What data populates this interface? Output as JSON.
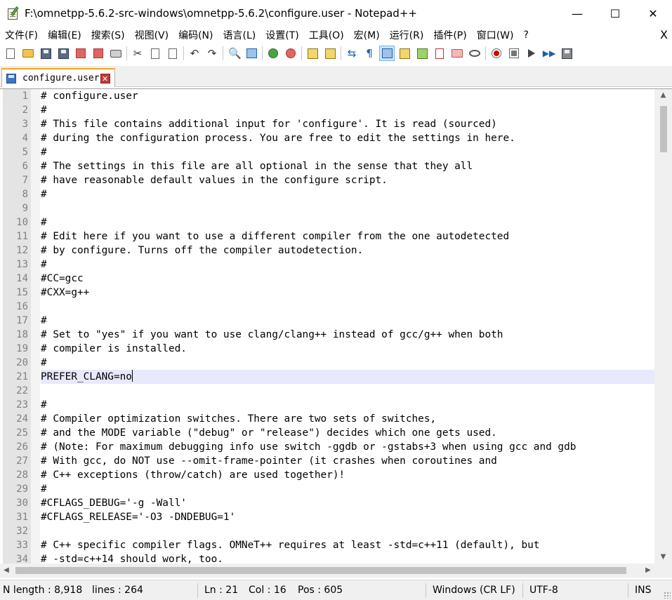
{
  "window": {
    "title": "F:\\omnetpp-5.6.2-src-windows\\omnetpp-5.6.2\\configure.user - Notepad++",
    "minimize_glyph": "—",
    "maximize_glyph": "☐",
    "close_glyph": "✕"
  },
  "menu": {
    "items": [
      "文件(F)",
      "编辑(E)",
      "搜索(S)",
      "视图(V)",
      "编码(N)",
      "语言(L)",
      "设置(T)",
      "工具(O)",
      "宏(M)",
      "运行(R)",
      "插件(P)",
      "窗口(W)",
      "?"
    ],
    "close_glyph": "X"
  },
  "toolbar": {
    "icons": [
      "new-file-icon",
      "open-file-icon",
      "save-icon",
      "save-all-icon",
      "close-icon",
      "close-all-icon",
      "print-icon",
      "cut-icon",
      "copy-icon",
      "paste-icon",
      "undo-icon",
      "redo-icon",
      "find-icon",
      "replace-icon",
      "zoom-in-icon",
      "zoom-out-icon",
      "sync-vertical-icon",
      "sync-horizontal-icon",
      "word-wrap-icon",
      "show-all-chars-icon",
      "indent-guide-icon",
      "user-language-icon",
      "doc-map-icon",
      "function-list-icon",
      "folder-workspace-icon",
      "monitor-icon",
      "record-macro-icon",
      "stop-record-icon",
      "play-macro-icon",
      "run-macro-multiple-icon",
      "save-macro-icon"
    ],
    "undo_glyph": "↶",
    "redo_glyph": "↷",
    "cut_glyph": "✂",
    "paragraph_glyph": "¶",
    "wrap_glyph": "⇆",
    "ff_glyph": "▶▶",
    "find_glyph": "🔍"
  },
  "tab": {
    "label": "configure.user",
    "close_glyph": "✕"
  },
  "editor": {
    "current_line": 21,
    "lines": [
      "# configure.user",
      "#",
      "# This file contains additional input for 'configure'. It is read (sourced)",
      "# during the configuration process. You are free to edit the settings in here.",
      "#",
      "# The settings in this file are all optional in the sense that they all",
      "# have reasonable default values in the configure script.",
      "#",
      "",
      "#",
      "# Edit here if you want to use a different compiler from the one autodetected",
      "# by configure. Turns off the compiler autodetection.",
      "#",
      "#CC=gcc",
      "#CXX=g++",
      "",
      "#",
      "# Set to \"yes\" if you want to use clang/clang++ instead of gcc/g++ when both",
      "# compiler is installed.",
      "#",
      "PREFER_CLANG=no",
      "",
      "#",
      "# Compiler optimization switches. There are two sets of switches,",
      "# and the MODE variable (\"debug\" or \"release\") decides which one gets used.",
      "# (Note: For maximum debugging info use switch -ggdb or -gstabs+3 when using gcc and gdb",
      "# With gcc, do NOT use --omit-frame-pointer (it crashes when coroutines and",
      "# C++ exceptions (throw/catch) are used together)!",
      "#",
      "#CFLAGS_DEBUG='-g -Wall'",
      "#CFLAGS_RELEASE='-O3 -DNDEBUG=1'",
      "",
      "# C++ specific compiler flags. OMNeT++ requires at least -std=c++11 (default), but",
      "# -std=c++14 should work, too."
    ]
  },
  "scrollbar": {
    "up_glyph": "▲",
    "down_glyph": "▼",
    "left_glyph": "◀",
    "right_glyph": "▶"
  },
  "status": {
    "length": "N length : 8,918",
    "lines": "lines : 264",
    "ln": "Ln : 21",
    "col": "Col : 16",
    "pos": "Pos : 605",
    "eol": "Windows (CR LF)",
    "encoding": "UTF-8",
    "mode": "INS"
  }
}
